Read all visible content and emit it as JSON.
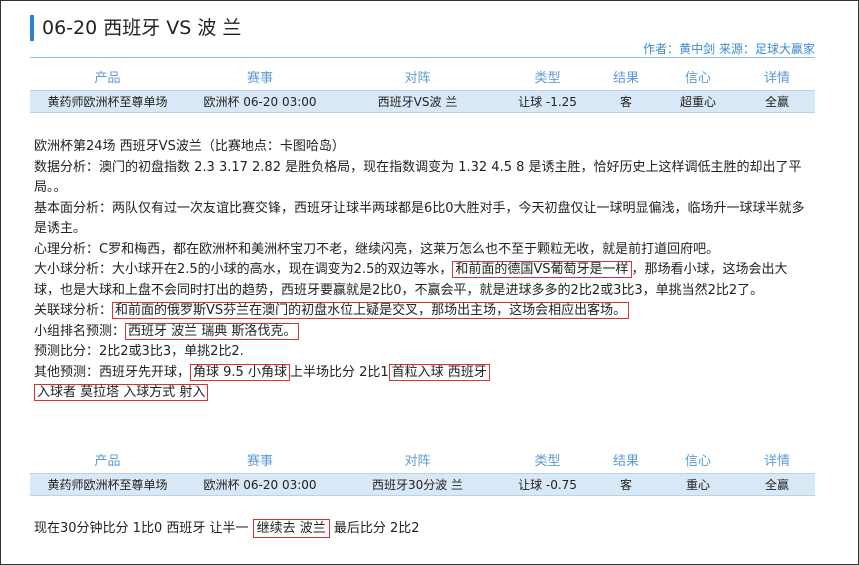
{
  "article": {
    "title": "06-20 西班牙 VS 波 兰",
    "meta": "作者：黄中剑 来源：足球大赢家"
  },
  "table_headers": [
    "产品",
    "赛事",
    "对阵",
    "类型",
    "结果",
    "信心",
    "详情"
  ],
  "table1_row": [
    "黄药师欧洲杯至尊单场",
    "欧洲杯 06-20 03:00",
    "西班牙VS波 兰",
    "让球 -1.25",
    "客",
    "超重心",
    "全赢"
  ],
  "table2_row": [
    "黄药师欧洲杯至尊单场",
    "欧洲杯 06-20 03:00",
    "西班牙30分波 兰",
    "让球 -0.75",
    "客",
    "重心",
    "全赢"
  ],
  "body": {
    "line1": "欧洲杯第24场 西班牙VS波兰（比赛地点：卡图哈岛）",
    "data_analysis": "数据分析：澳门的初盘指数 2.3 3.17 2.82 是胜负格局，现在指数调变为 1.32 4.5 8 是诱主胜，恰好历史上这样调低主胜的却出了平局。。",
    "basic_analysis": "基本面分析：两队仅有过一次友谊比赛交锋，西班牙让球半两球都是6比0大胜对手，今天初盘仅让一球明显偏浅，临场升一球球半就多是诱主。",
    "psych_analysis": "心理分析：C罗和梅西，都在欧洲杯和美洲杯宝刀不老，继续闪亮，这莱万怎么也不至于颗粒无收，就是前打道回府吧。",
    "ou_prefix": "大小球分析：大小球开在2.5的小球的高水，现在调变为2.5的双边等水，",
    "ou_box": "和前面的德国VS葡萄牙是一样",
    "ou_suffix": "，那场看小球，这场会出大球，也是大球和上盘不会同时打出的趋势，西班牙要赢就是2比0，不赢会平，就是进球多多的2比2或3比3，单挑当然2比2了。",
    "assoc_prefix": "关联球分析：",
    "assoc_box": "和前面的俄罗斯VS芬兰在澳门的初盘水位上疑是交叉，那场出主场，这场会相应出客场。",
    "group_prefix": "小组排名预测：",
    "group_box": "西班牙 波兰 瑞典 斯洛伐克。",
    "score_pred": "预测比分：2比2或3比3，单挑2比2.",
    "other_prefix": "其他预测：西班牙先开球，",
    "other_box1": "角球 9.5 小角球",
    "other_mid": "上半场比分 2比1",
    "other_box2": "首粒入球 西班牙",
    "other_box3": "入球者 莫拉塔 入球方式 射入"
  },
  "tail": {
    "prefix": "现在30分钟比分  1比0  西班牙 让半一",
    "box": "继续去 波兰",
    "suffix": "最后比分  2比2"
  }
}
